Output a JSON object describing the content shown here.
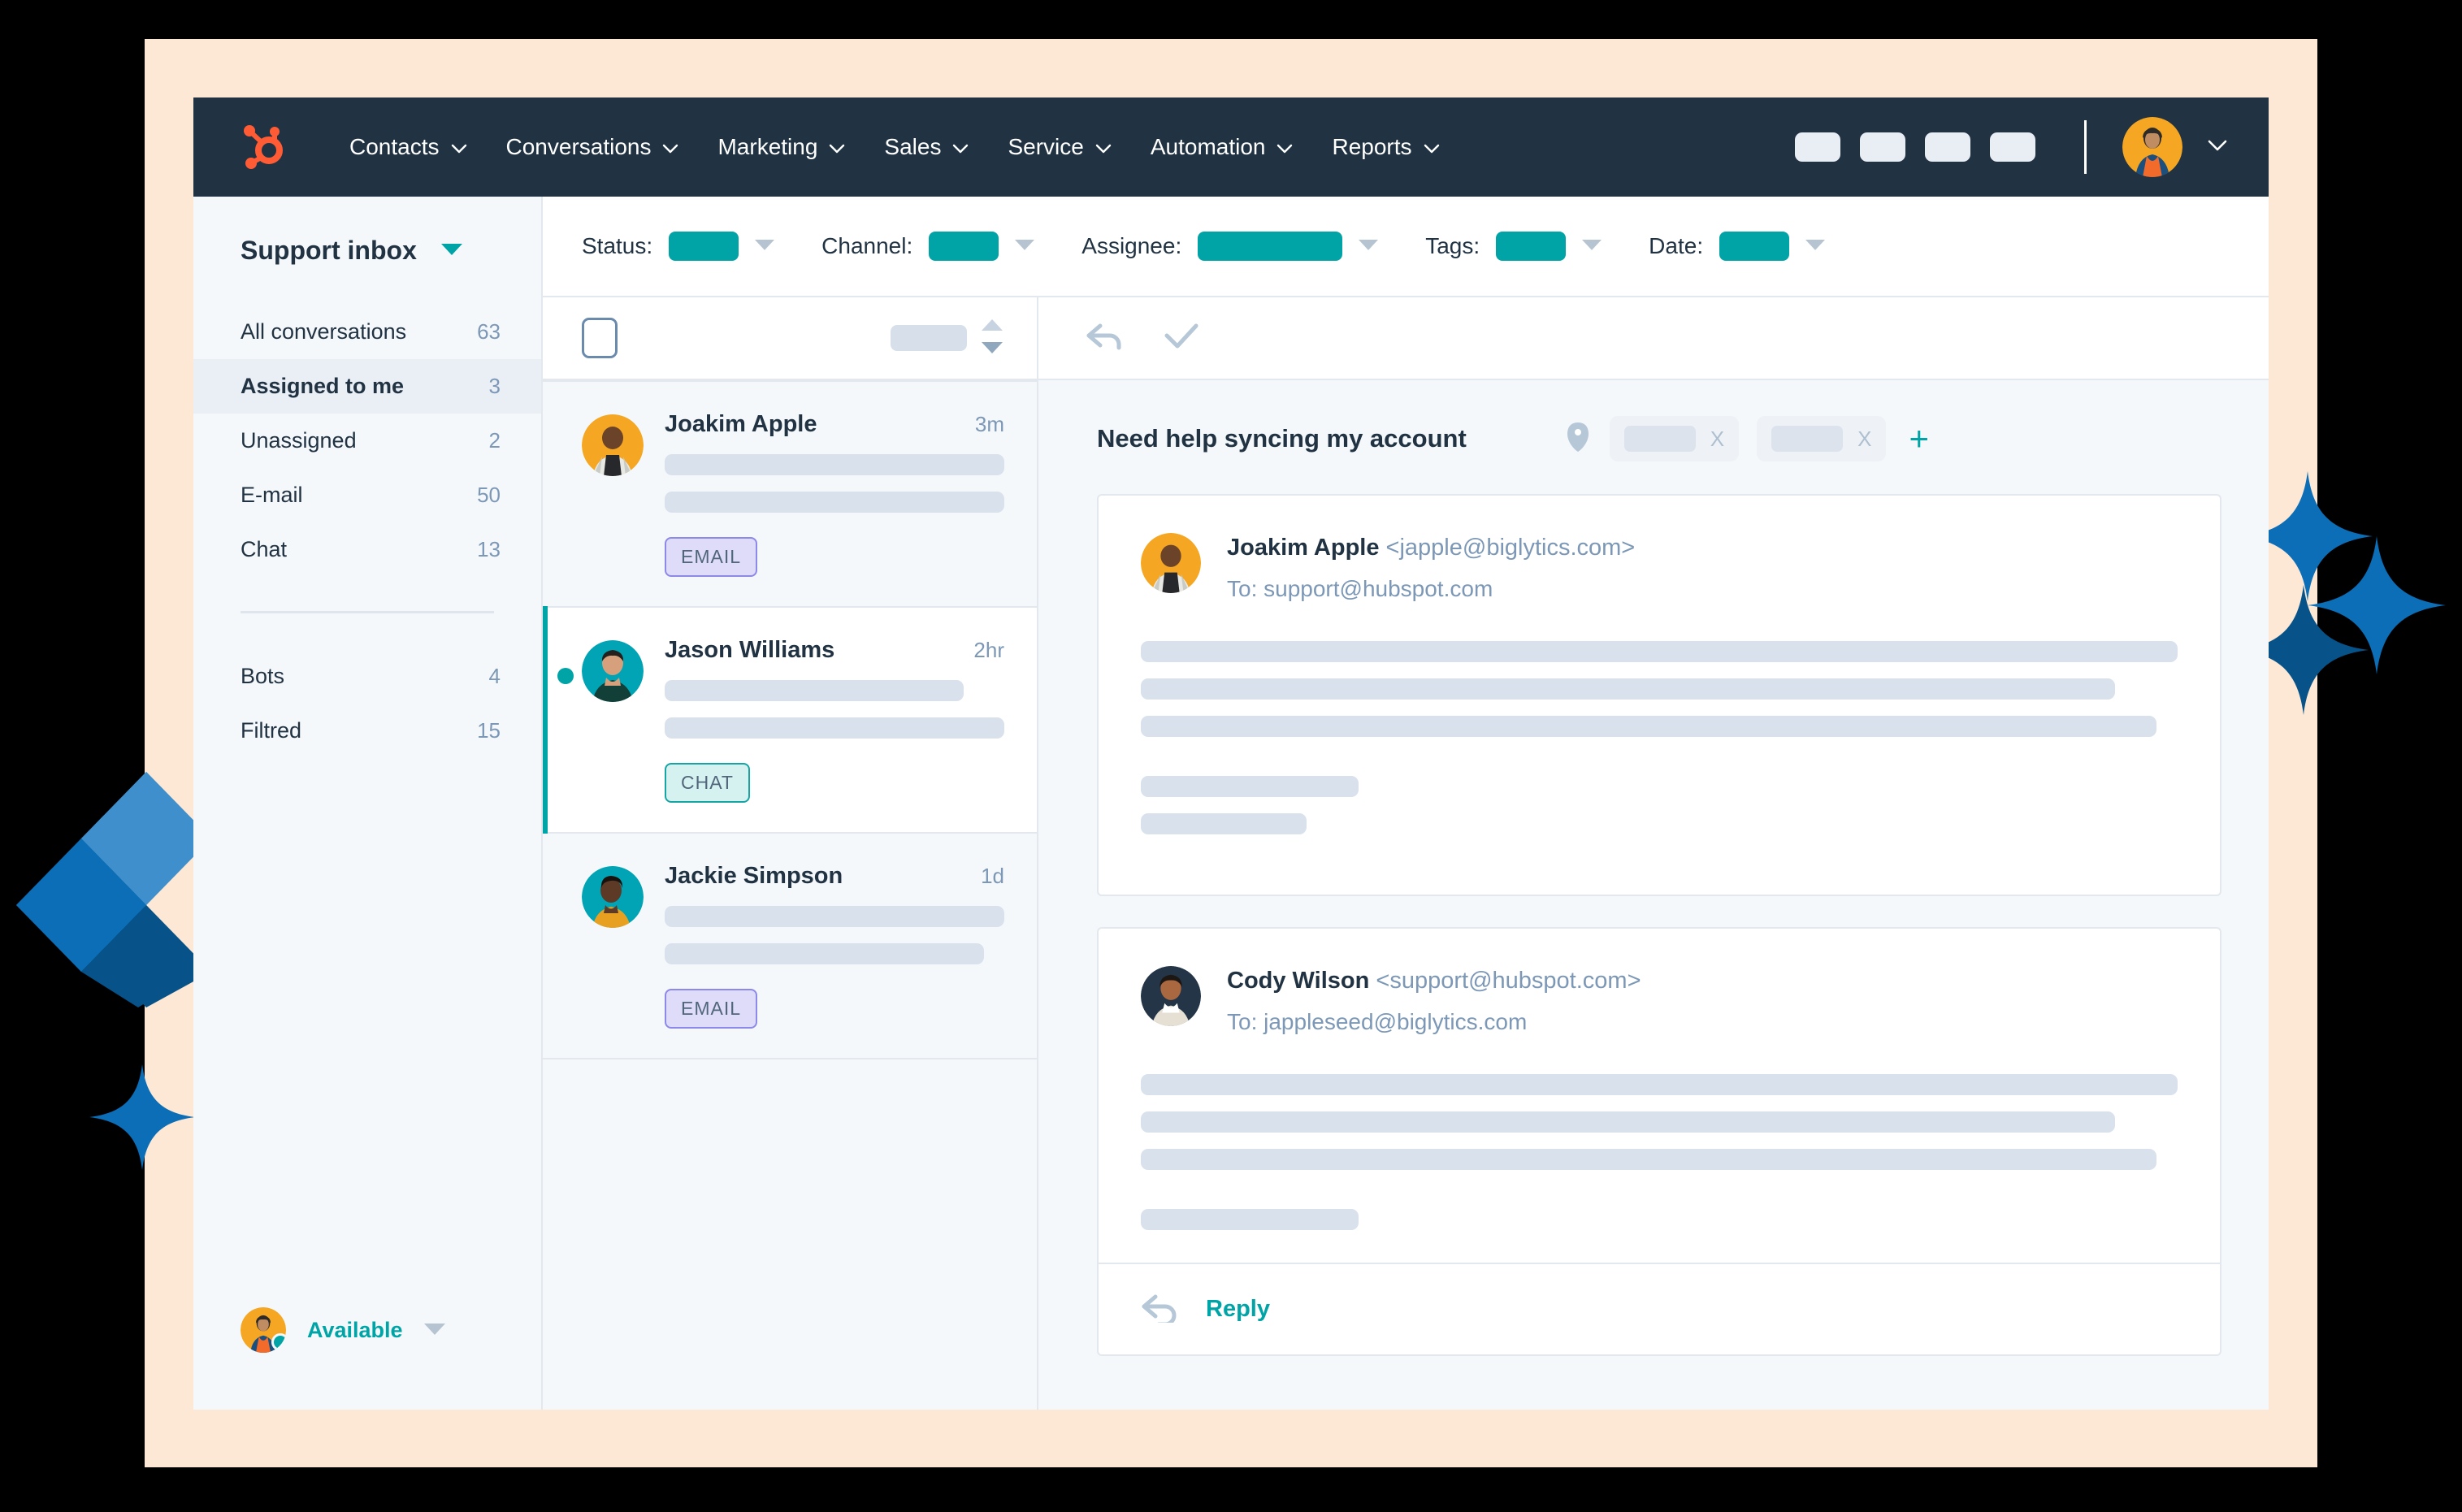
{
  "theme": {
    "backdrop": "#000000",
    "peach_panel": "#FCE8D5",
    "nav_bg": "#213343",
    "accent_teal": "#00A4A6",
    "brand_orange": "#FF5C35",
    "deco_blue": "#0B6EB7",
    "surface": "#F5F8FA"
  },
  "topnav": {
    "logo_icon": "hubspot-sprocket-logo",
    "items": [
      {
        "label": "Contacts",
        "icon": "chevron-down-icon"
      },
      {
        "label": "Conversations",
        "icon": "chevron-down-icon"
      },
      {
        "label": "Marketing",
        "icon": "chevron-down-icon"
      },
      {
        "label": "Sales",
        "icon": "chevron-down-icon"
      },
      {
        "label": "Service",
        "icon": "chevron-down-icon"
      },
      {
        "label": "Automation",
        "icon": "chevron-down-icon"
      },
      {
        "label": "Reports",
        "icon": "chevron-down-icon"
      }
    ],
    "action_chips": [
      "chip-1",
      "chip-2",
      "chip-3",
      "chip-4"
    ],
    "avatar_icon": "user-avatar",
    "avatar_chevron_icon": "chevron-down-icon"
  },
  "sidebar": {
    "inbox_title": "Support inbox",
    "inbox_chevron_icon": "caret-down-icon",
    "items": [
      {
        "label": "All conversations",
        "count": "63",
        "active": false
      },
      {
        "label": "Assigned to me",
        "count": "3",
        "active": true
      },
      {
        "label": "Unassigned",
        "count": "2",
        "active": false
      },
      {
        "label": "E-mail",
        "count": "50",
        "active": false
      },
      {
        "label": "Chat",
        "count": "13",
        "active": false
      }
    ],
    "secondary_items": [
      {
        "label": "Bots",
        "count": "4"
      },
      {
        "label": "Filtred",
        "count": "15"
      }
    ],
    "status": {
      "label": "Available",
      "chevron_icon": "caret-down-icon",
      "avatar_icon": "user-avatar",
      "dot_color": "#00A4A6"
    }
  },
  "filter_bar": {
    "filters": [
      {
        "label": "Status:",
        "value_width": 86,
        "chevron_icon": "caret-down-icon"
      },
      {
        "label": "Channel:",
        "value_width": 86,
        "chevron_icon": "caret-down-icon"
      },
      {
        "label": "Assignee:",
        "value_width": 178,
        "chevron_icon": "caret-down-icon"
      },
      {
        "label": "Tags:",
        "value_width": 86,
        "chevron_icon": "caret-down-icon"
      },
      {
        "label": "Date:",
        "value_width": 86,
        "chevron_icon": "caret-down-icon"
      }
    ]
  },
  "convo_toolbar": {
    "select_all_icon": "checkbox-icon",
    "sort_placeholder": "sort-value-pill",
    "sort_up_icon": "caret-up-icon",
    "sort_down_icon": "caret-down-icon"
  },
  "thread_toolbar": {
    "reply_icon": "reply-arrow-icon",
    "done_icon": "checkmark-icon"
  },
  "conversations": [
    {
      "name": "Joakim Apple",
      "time": "3m",
      "badge": "EMAIL",
      "badge_type": "email",
      "unread": false,
      "selected": false,
      "preview_widths": [
        100,
        100
      ]
    },
    {
      "name": "Jason Williams",
      "time": "2hr",
      "badge": "CHAT",
      "badge_type": "chat",
      "unread": true,
      "selected": true,
      "preview_widths": [
        88,
        100
      ]
    },
    {
      "name": "Jackie Simpson",
      "time": "1d",
      "badge": "EMAIL",
      "badge_type": "email",
      "unread": false,
      "selected": false,
      "preview_widths": [
        100,
        94
      ]
    }
  ],
  "thread": {
    "title": "Need help syncing my account",
    "tag_icon": "tag-icon",
    "tag_chips": [
      {
        "remove_icon": "x-icon",
        "remove_label": "X"
      },
      {
        "remove_icon": "x-icon",
        "remove_label": "X"
      }
    ],
    "add_tag_label": "+",
    "messages": [
      {
        "sender_name": "Joakim Apple",
        "sender_address": "<japple@biglytics.com>",
        "recipient": "To: support@hubspot.com",
        "avatar_icon": "user-avatar",
        "body_line_widths": [
          100,
          94,
          98,
          17,
          10
        ]
      },
      {
        "sender_name": "Cody Wilson",
        "sender_address": "<support@hubspot.com>",
        "recipient": "To: jappleseed@biglytics.com",
        "avatar_icon": "user-avatar",
        "body_line_widths": [
          100,
          94,
          98,
          17
        ]
      }
    ],
    "reply": {
      "label": "Reply",
      "icon": "reply-arrow-icon"
    }
  }
}
